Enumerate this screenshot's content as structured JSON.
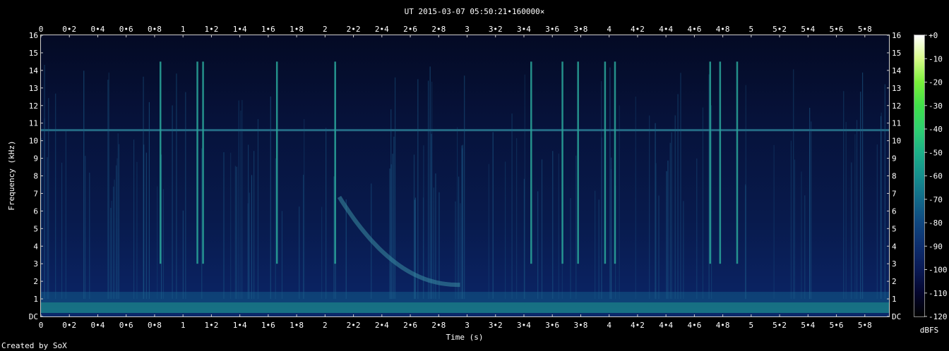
{
  "chart_data": {
    "type": "heatmap",
    "title": "UT 2015-03-07 05:50:21•160000×",
    "xlabel": "Time (s)",
    "ylabel": "Frequency (kHz)",
    "xlim": [
      0,
      5.97
    ],
    "ylim": [
      0,
      16
    ],
    "x_ticks": [
      "0",
      "0•2",
      "0•4",
      "0•6",
      "0•8",
      "1",
      "1•2",
      "1•4",
      "1•6",
      "1•8",
      "2",
      "2•2",
      "2•4",
      "2•6",
      "2•8",
      "3",
      "3•2",
      "3•4",
      "3•6",
      "3•8",
      "4",
      "4•2",
      "4•4",
      "4•6",
      "4•8",
      "5",
      "5•2",
      "5•4",
      "5•6",
      "5•8"
    ],
    "y_ticks": [
      "DC",
      "1",
      "2",
      "3",
      "4",
      "5",
      "6",
      "7",
      "8",
      "9",
      "10",
      "11",
      "12",
      "13",
      "14",
      "15",
      "16"
    ],
    "colorbar": {
      "label": "dBFS",
      "range": [
        -120,
        0
      ],
      "ticks": [
        "+0",
        "-10",
        "-20",
        "-30",
        "-40",
        "-50",
        "-60",
        "-70",
        "-80",
        "-90",
        "-100",
        "-110",
        "-120"
      ],
      "colors": [
        "#000000",
        "#05062e",
        "#0a1a55",
        "#0d2e6e",
        "#0f4780",
        "#126a8a",
        "#158f8e",
        "#1cb088",
        "#2fd070",
        "#40e04a",
        "#7af03a",
        "#d8fb8a",
        "#ffffff"
      ]
    },
    "features": {
      "persistent_band_khz": 10.6,
      "low_freq_band_khz": [
        0.2,
        0.8
      ],
      "whistler": {
        "start_s": 2.1,
        "start_khz": 6.8,
        "end_s": 2.95,
        "end_khz": 1.8
      },
      "bright_vertical_spikes_s": [
        0.84,
        1.1,
        1.14,
        1.66,
        2.07,
        3.45,
        3.67,
        3.78,
        3.97,
        4.04,
        4.71,
        4.78,
        4.9
      ]
    }
  },
  "footer": {
    "credit": "Created by SoX"
  }
}
